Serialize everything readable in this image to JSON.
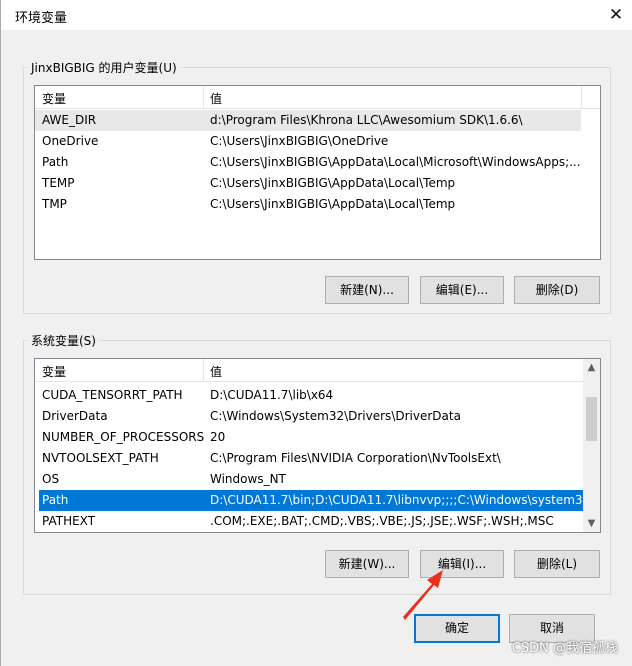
{
  "window": {
    "title": "环境变量",
    "close_glyph": "✕"
  },
  "user_group": {
    "label": "JinxBIGBIG 的用户变量(U)",
    "col_var": "变量",
    "col_val": "值",
    "rows": [
      {
        "name": "AWE_DIR",
        "value": "d:\\Program Files\\Khrona LLC\\Awesomium SDK\\1.6.6\\"
      },
      {
        "name": "OneDrive",
        "value": "C:\\Users\\JinxBIGBIG\\OneDrive"
      },
      {
        "name": "Path",
        "value": "C:\\Users\\JinxBIGBIG\\AppData\\Local\\Microsoft\\WindowsApps;..."
      },
      {
        "name": "TEMP",
        "value": "C:\\Users\\JinxBIGBIG\\AppData\\Local\\Temp"
      },
      {
        "name": "TMP",
        "value": "C:\\Users\\JinxBIGBIG\\AppData\\Local\\Temp"
      }
    ],
    "buttons": {
      "new": "新建(N)...",
      "edit": "编辑(E)...",
      "delete": "删除(D)"
    }
  },
  "sys_group": {
    "label": "系统变量(S)",
    "col_var": "变量",
    "col_val": "值",
    "rows": [
      {
        "name": "CUDA_TENSORRT_PATH",
        "value": "D:\\CUDA11.7\\lib\\x64"
      },
      {
        "name": "DriverData",
        "value": "C:\\Windows\\System32\\Drivers\\DriverData"
      },
      {
        "name": "NUMBER_OF_PROCESSORS",
        "value": "20"
      },
      {
        "name": "NVTOOLSEXT_PATH",
        "value": "C:\\Program Files\\NVIDIA Corporation\\NvToolsExt\\"
      },
      {
        "name": "OS",
        "value": "Windows_NT"
      },
      {
        "name": "Path",
        "value": "D:\\CUDA11.7\\bin;D:\\CUDA11.7\\libnvvp;;;;C:\\Windows\\system3..."
      },
      {
        "name": "PATHEXT",
        "value": ".COM;.EXE;.BAT;.CMD;.VBS;.VBE;.JS;.JSE;.WSF;.WSH;.MSC"
      }
    ],
    "selected_index": 5,
    "buttons": {
      "new": "新建(W)...",
      "edit": "编辑(I)...",
      "delete": "删除(L)"
    }
  },
  "footer": {
    "ok": "确定",
    "cancel": "取消"
  },
  "watermark": "CSDN @我宿孤栈",
  "colors": {
    "selection": "#0078d7",
    "arrow": "#e8301c"
  },
  "icons": {
    "close": "close-icon",
    "scroll_up": "chevron-up-icon",
    "scroll_down": "chevron-down-icon"
  }
}
